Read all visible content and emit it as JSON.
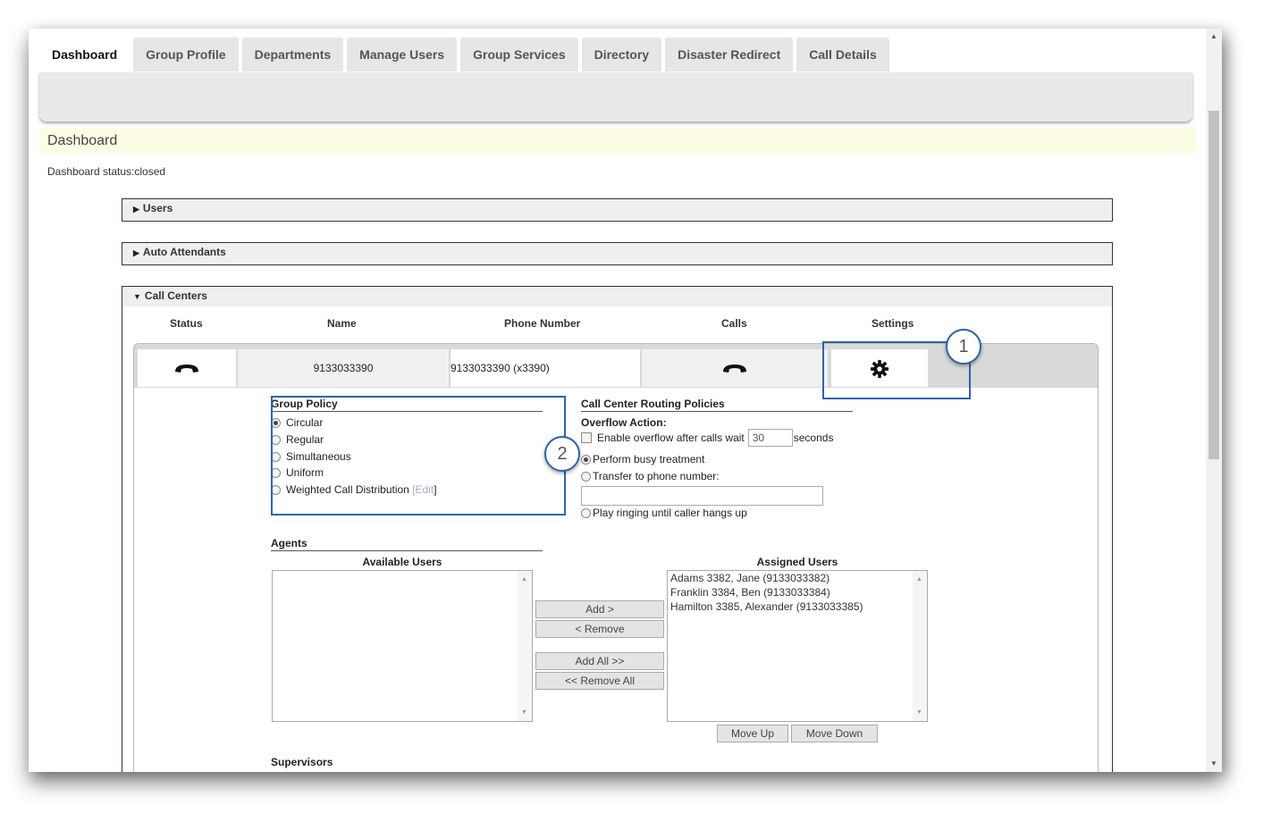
{
  "tabs": [
    "Dashboard",
    "Group Profile",
    "Departments",
    "Manage Users",
    "Group Services",
    "Directory",
    "Disaster Redirect",
    "Call Details"
  ],
  "page": {
    "title": "Dashboard",
    "status": "Dashboard status:closed"
  },
  "sections": {
    "users": "Users",
    "auto_attendants": "Auto Attendants",
    "call_centers": "Call Centers"
  },
  "columns": {
    "status": "Status",
    "name": "Name",
    "phone": "Phone Number",
    "calls": "Calls",
    "settings": "Settings"
  },
  "call_center": {
    "name": "9133033390",
    "phone": "9133033390 (x3390)",
    "status_icon": "phone-icon",
    "calls_icon": "phone-icon",
    "settings_icon": "gear-icon"
  },
  "group_policy": {
    "heading": "Group Policy",
    "options": [
      "Circular",
      "Regular",
      "Simultaneous",
      "Uniform",
      "Weighted Call Distribution"
    ],
    "selected": "Circular",
    "edit_open": "[",
    "edit_label": "Edit",
    "edit_close": "]"
  },
  "routing": {
    "heading": "Call Center Routing Policies",
    "overflow_heading": "Overflow Action:",
    "enable_overflow_label": "Enable overflow after calls wait",
    "wait_value": "30",
    "seconds_label": "seconds",
    "busy_label": "Perform busy treatment",
    "transfer_label": "Transfer to phone number:",
    "transfer_value": "",
    "ringing_label": "Play ringing until caller hangs up"
  },
  "agents": {
    "heading": "Agents",
    "available_heading": "Available Users",
    "assigned_heading": "Assigned Users",
    "available": [],
    "assigned": [
      "Adams 3382, Jane (9133033382)",
      "Franklin 3384, Ben (9133033384)",
      "Hamilton 3385, Alexander (9133033385)"
    ],
    "add": "Add >",
    "remove": "< Remove",
    "add_all": "Add All >>",
    "remove_all": "<< Remove All",
    "move_up": "Move Up",
    "move_down": "Move Down"
  },
  "supervisors_heading": "Supervisors",
  "callouts": [
    "1",
    "2"
  ],
  "colors": {
    "callout": "#2f64a8",
    "title_bar": "#fdfde5"
  }
}
